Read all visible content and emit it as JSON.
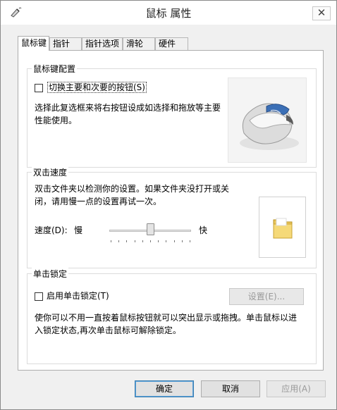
{
  "window": {
    "title": "鼠标 属性",
    "close_label": "✕"
  },
  "tabs": [
    "鼠标键",
    "指针",
    "指针选项",
    "滑轮",
    "硬件"
  ],
  "button_config": {
    "title": "鼠标键配置",
    "switch_checkbox_label": "切换主要和次要的按钮(S)",
    "switch_checked": false,
    "description_line1": "选择此复选框来将右按钮设成如选择和拖放等主要",
    "description_line2": "性能使用。"
  },
  "double_click": {
    "title": "双击速度",
    "description_line1": "双击文件夹以检测你的设置。如果文件夹没打开或关",
    "description_line2": "闭，请用慢一点的设置再试一次。",
    "speed_label": "速度(D):",
    "slow_label": "慢",
    "fast_label": "快",
    "speed_value_fraction": 0.5
  },
  "click_lock": {
    "title": "单击锁定",
    "enable_label": "启用单击锁定(T)",
    "enable_checked": false,
    "settings_button": "设置(E)...",
    "description_line1": "使你可以不用一直按着鼠标按钮就可以突出显示或拖拽。单击鼠标以进",
    "description_line2": "入锁定状态,再次单击鼠标可解除锁定。"
  },
  "footer": {
    "ok": "确定",
    "cancel": "取消",
    "apply": "应用(A)"
  }
}
